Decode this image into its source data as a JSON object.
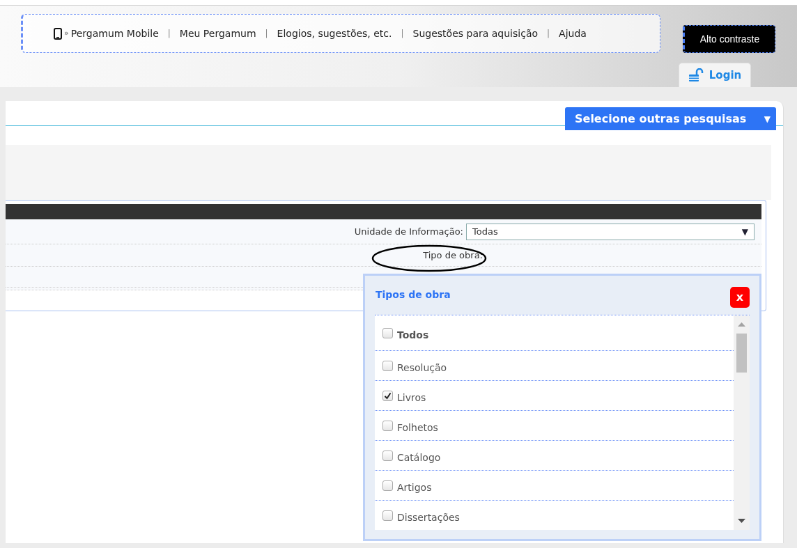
{
  "nav": {
    "links": [
      {
        "text": "Pergamum Mobile",
        "prefix": "»",
        "kind": "mobile"
      },
      {
        "text": "Meu Pergamum",
        "separator": "|",
        "kind": "plain"
      },
      {
        "text": "Elogios, sugestões, etc.",
        "separator": "|",
        "kind": "plain"
      },
      {
        "text": "Sugestões para aquisição",
        "separator": "|",
        "kind": "plain"
      },
      {
        "text": "Ajuda",
        "separator": "|",
        "kind": "plain"
      }
    ]
  },
  "contrast_button": "Alto contraste",
  "login_tab": "Login",
  "other_searches_button": {
    "label": "Selecione outras pesquisas",
    "caret": "▼"
  },
  "form": {
    "unit_label": "Unidade de Informação:",
    "unit_select": {
      "value": "Todas",
      "caret": "▼"
    },
    "type_label": "Tipo de obra:"
  },
  "popup": {
    "title": "Tipos de obra",
    "close": "x",
    "items": [
      {
        "label": "Todos",
        "checked": false,
        "kind": "all"
      },
      {
        "label": "Resolução",
        "checked": false,
        "kind": "type"
      },
      {
        "label": "Livros",
        "checked": true,
        "kind": "type"
      },
      {
        "label": "Folhetos",
        "checked": false,
        "kind": "type"
      },
      {
        "label": "Catálogo",
        "checked": false,
        "kind": "type"
      },
      {
        "label": "Artigos",
        "checked": false,
        "kind": "type"
      },
      {
        "label": "Dissertações",
        "checked": false,
        "kind": "type"
      }
    ]
  }
}
